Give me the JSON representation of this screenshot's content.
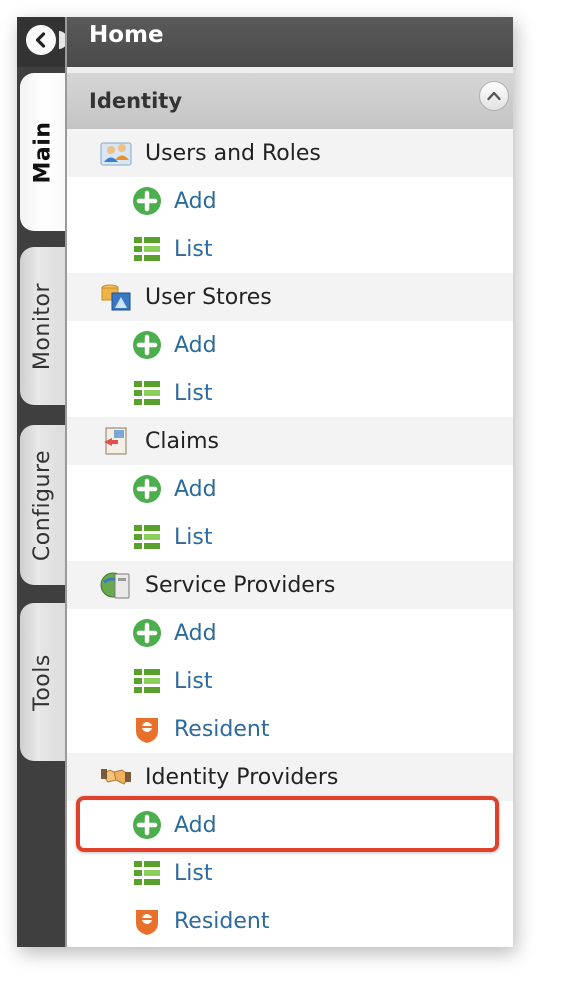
{
  "header": {
    "title": "Home"
  },
  "tabs": [
    {
      "label": "Main",
      "active": true
    },
    {
      "label": "Monitor",
      "active": false
    },
    {
      "label": "Configure",
      "active": false
    },
    {
      "label": "Tools",
      "active": false
    }
  ],
  "section": {
    "title": "Identity"
  },
  "groups": [
    {
      "label": "Users and Roles",
      "icon": "users-icon",
      "items": [
        {
          "label": "Add",
          "icon": "add-icon"
        },
        {
          "label": "List",
          "icon": "list-icon"
        }
      ]
    },
    {
      "label": "User Stores",
      "icon": "user-stores-icon",
      "items": [
        {
          "label": "Add",
          "icon": "add-icon"
        },
        {
          "label": "List",
          "icon": "list-icon"
        }
      ]
    },
    {
      "label": "Claims",
      "icon": "claims-icon",
      "items": [
        {
          "label": "Add",
          "icon": "add-icon"
        },
        {
          "label": "List",
          "icon": "list-icon"
        }
      ]
    },
    {
      "label": "Service Providers",
      "icon": "service-providers-icon",
      "items": [
        {
          "label": "Add",
          "icon": "add-icon"
        },
        {
          "label": "List",
          "icon": "list-icon"
        },
        {
          "label": "Resident",
          "icon": "resident-icon"
        }
      ]
    },
    {
      "label": "Identity Providers",
      "icon": "identity-providers-icon",
      "items": [
        {
          "label": "Add",
          "icon": "add-icon"
        },
        {
          "label": "List",
          "icon": "list-icon"
        },
        {
          "label": "Resident",
          "icon": "resident-icon"
        }
      ]
    }
  ],
  "colors": {
    "link": "#2e6a9c",
    "highlight": "#e0402c",
    "add_green": "#4cae4c",
    "resident_orange": "#e8702a"
  }
}
